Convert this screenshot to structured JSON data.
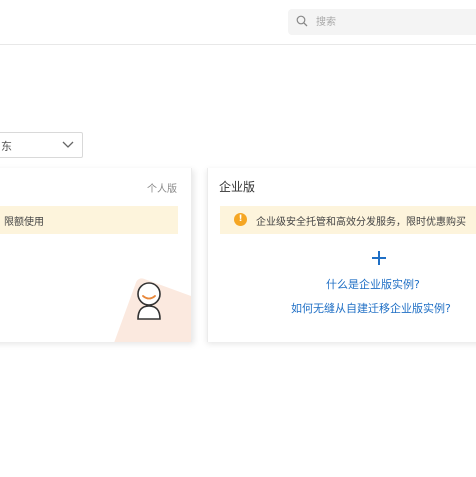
{
  "search": {
    "placeholder": "搜索"
  },
  "region_select": {
    "value": "东"
  },
  "personal_card": {
    "edition_tag": "个人版",
    "notice": "限额使用"
  },
  "enterprise_card": {
    "title": "企业版",
    "notice": "企业级安全托管和高效分发服务，限时优惠购买",
    "link_what": "什么是企业版实例?",
    "link_migrate": "如何无缝从自建迁移企业版实例?"
  },
  "colors": {
    "notice_bg": "#fdf4dc",
    "warning": "#f5a623",
    "link": "#1f6fc5",
    "accent_orange": "#e8873a"
  },
  "icons": [
    "search-icon",
    "chevron-down-icon",
    "warning-icon",
    "plus-icon",
    "avatar-icon"
  ]
}
